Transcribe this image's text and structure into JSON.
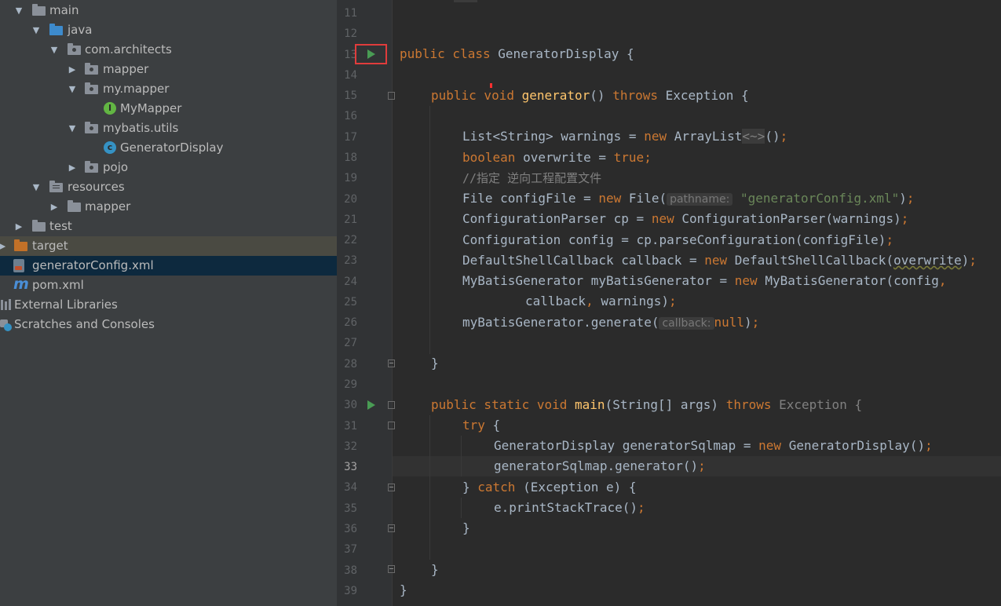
{
  "project_tree": {
    "items": [
      {
        "label": "main",
        "icon": "folder-icon"
      },
      {
        "label": "java",
        "icon": "source-folder-icon"
      },
      {
        "label": "com.architects",
        "icon": "package-icon"
      },
      {
        "label": "mapper",
        "icon": "package-icon"
      },
      {
        "label": "my.mapper",
        "icon": "package-icon"
      },
      {
        "label": "MyMapper",
        "icon": "interface-icon"
      },
      {
        "label": "mybatis.utils",
        "icon": "package-icon"
      },
      {
        "label": "GeneratorDisplay",
        "icon": "class-icon"
      },
      {
        "label": "pojo",
        "icon": "package-icon"
      },
      {
        "label": "resources",
        "icon": "resources-folder-icon"
      },
      {
        "label": "mapper",
        "icon": "folder-icon"
      },
      {
        "label": "test",
        "icon": "folder-icon"
      },
      {
        "label": "target",
        "icon": "excluded-folder-icon"
      },
      {
        "label": "generatorConfig.xml",
        "icon": "xml-file-icon"
      },
      {
        "label": "pom.xml",
        "icon": "maven-icon"
      },
      {
        "label": "External Libraries",
        "icon": "libraries-icon"
      },
      {
        "label": "Scratches and Consoles",
        "icon": "scratches-icon"
      }
    ]
  },
  "editor": {
    "line_numbers": [
      "11",
      "12",
      "13",
      "14",
      "15",
      "16",
      "17",
      "18",
      "19",
      "20",
      "21",
      "22",
      "23",
      "24",
      "25",
      "26",
      "27",
      "28",
      "29",
      "30",
      "31",
      "32",
      "33",
      "34",
      "35",
      "36",
      "37",
      "38",
      "39"
    ],
    "current_line": "33",
    "hints": {
      "pathname": "pathname:",
      "callback": "callback:"
    },
    "code": {
      "l13a": "public class ",
      "l13b": "GeneratorDisplay {",
      "l15a": "public void ",
      "l15b": "generator",
      "l15c": "() ",
      "l15d": "throws ",
      "l15e": "Exception {",
      "l17a": "List<String> warnings = ",
      "l17b": "new ",
      "l17c": "ArrayList",
      "l17d": "<~>",
      "l17e": "()",
      "l17f": ";",
      "l18a": "boolean ",
      "l18b": "overwrite = ",
      "l18c": "true",
      "l18d": ";",
      "l19": "//指定 逆向工程配置文件",
      "l20a": "File configFile = ",
      "l20b": "new ",
      "l20c": "File(",
      "l20d": "\"generatorConfig.xml\"",
      "l20e": ")",
      "l20f": ";",
      "l21a": "ConfigurationParser cp = ",
      "l21b": "new ",
      "l21c": "ConfigurationParser(warnings)",
      "l21d": ";",
      "l22a": "Configuration config = cp.parseConfiguration(configFile)",
      "l22b": ";",
      "l23a": "DefaultShellCallback callback = ",
      "l23b": "new ",
      "l23c": "DefaultShellCallback(",
      "l23d": "overwrite",
      "l23e": ")",
      "l23f": ";",
      "l24a": "MyBatisGenerator myBatisGenerator = ",
      "l24b": "new ",
      "l24c": "MyBatisGenerator(config",
      "l24d": ",",
      "l25a": "callback",
      "l25b": ", ",
      "l25c": "warnings)",
      "l25d": ";",
      "l26a": "myBatisGenerator.generate(",
      "l26b": "null",
      "l26c": ")",
      "l26d": ";",
      "l28": "}",
      "l30a": "public static void ",
      "l30b": "main",
      "l30c": "(String[] args) ",
      "l30d": "throws ",
      "l30e": "Exception {",
      "l31a": "try ",
      "l31b": "{",
      "l32a": "GeneratorDisplay generatorSqlmap = ",
      "l32b": "new ",
      "l32c": "GeneratorDisplay()",
      "l32d": ";",
      "l33a": "generatorSqlmap.generator()",
      "l33b": ";",
      "l34a": "} ",
      "l34b": "catch ",
      "l34c": "(Exception e) {",
      "l35a": "e.printStackTrace()",
      "l35b": ";",
      "l36": "}",
      "l38": "}",
      "l39": "}"
    }
  },
  "colors": {
    "keyword": "#cc7832",
    "function": "#ffc66d",
    "string": "#6a8759",
    "comment": "#808080",
    "run_icon": "#499c54",
    "highlight_box": "#e03c3c"
  }
}
